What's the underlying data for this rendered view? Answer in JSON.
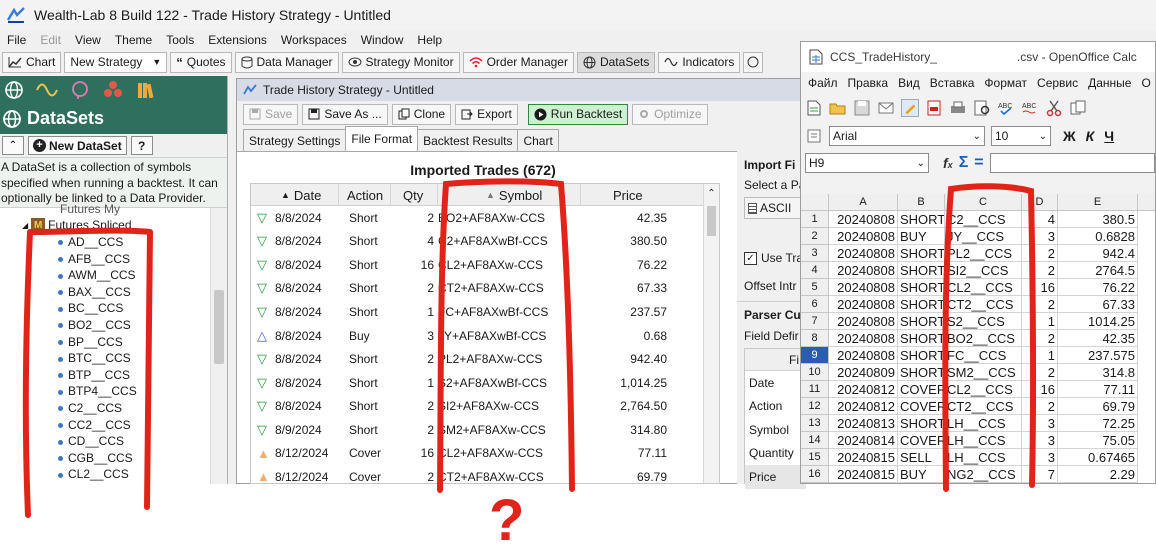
{
  "wl": {
    "title": "Wealth-Lab 8 Build 122 - Trade History Strategy - Untitled",
    "menu": [
      "File",
      "Edit",
      "View",
      "Theme",
      "Tools",
      "Extensions",
      "Workspaces",
      "Window",
      "Help"
    ],
    "toolbar": {
      "chart": "Chart",
      "new_strategy": "New Strategy",
      "quotes": "Quotes",
      "data_manager": "Data Manager",
      "strategy_monitor": "Strategy Monitor",
      "order_manager": "Order Manager",
      "datasets": "DataSets",
      "indicators": "Indicators"
    }
  },
  "datasets_panel": {
    "title": "DataSets",
    "new_dataset": "New DataSet",
    "help": "?",
    "description": "A DataSet is a collection of symbols specified when running a backtest. It can optionally be linked to a Data Provider.",
    "partial_item": "Futures My",
    "folder": "Futures Spliced",
    "symbols": [
      "AD__CCS",
      "AFB__CCS",
      "AWM__CCS",
      "BAX__CCS",
      "BC__CCS",
      "BO2__CCS",
      "BP__CCS",
      "BTC__CCS",
      "BTP__CCS",
      "BTP4__CCS",
      "C2__CCS",
      "CC2__CCS",
      "CD__CCS",
      "CGB__CCS",
      "CL2__CCS"
    ]
  },
  "strategy": {
    "title": "Trade History Strategy - Untitled",
    "buttons": {
      "save": "Save",
      "save_as": "Save As ...",
      "clone": "Clone",
      "export": "Export",
      "run": "Run Backtest",
      "optimize": "Optimize"
    },
    "tabs": [
      "Strategy Settings",
      "File Format",
      "Backtest Results",
      "Chart"
    ],
    "imported_title": "Imported Trades (672)",
    "columns": [
      "Date",
      "Action",
      "Qty",
      "Symbol",
      "Price"
    ],
    "trades": [
      {
        "date": "8/8/2024",
        "action": "Short",
        "qty": "2",
        "symbol": "BO2+AF8AXw-CCS",
        "price": "42.35",
        "kind": "short"
      },
      {
        "date": "8/8/2024",
        "action": "Short",
        "qty": "4",
        "symbol": "C2+AF8AXwBf-CCS",
        "price": "380.50",
        "kind": "short"
      },
      {
        "date": "8/8/2024",
        "action": "Short",
        "qty": "16",
        "symbol": "CL2+AF8AXw-CCS",
        "price": "76.22",
        "kind": "short"
      },
      {
        "date": "8/8/2024",
        "action": "Short",
        "qty": "2",
        "symbol": "CT2+AF8AXw-CCS",
        "price": "67.33",
        "kind": "short"
      },
      {
        "date": "8/8/2024",
        "action": "Short",
        "qty": "1",
        "symbol": "FC+AF8AXwBf-CCS",
        "price": "237.57",
        "kind": "short"
      },
      {
        "date": "8/8/2024",
        "action": "Buy",
        "qty": "3",
        "symbol": "JY+AF8AXwBf-CCS",
        "price": "0.68",
        "kind": "buy"
      },
      {
        "date": "8/8/2024",
        "action": "Short",
        "qty": "2",
        "symbol": "PL2+AF8AXw-CCS",
        "price": "942.40",
        "kind": "short"
      },
      {
        "date": "8/8/2024",
        "action": "Short",
        "qty": "1",
        "symbol": "S2+AF8AXwBf-CCS",
        "price": "1,014.25",
        "kind": "short"
      },
      {
        "date": "8/8/2024",
        "action": "Short",
        "qty": "2",
        "symbol": "SI2+AF8AXw-CCS",
        "price": "2,764.50",
        "kind": "short"
      },
      {
        "date": "8/9/2024",
        "action": "Short",
        "qty": "2",
        "symbol": "SM2+AF8AXw-CCS",
        "price": "314.80",
        "kind": "short"
      },
      {
        "date": "8/12/2024",
        "action": "Cover",
        "qty": "16",
        "symbol": "CL2+AF8AXw-CCS",
        "price": "77.11",
        "kind": "cover"
      },
      {
        "date": "8/12/2024",
        "action": "Cover",
        "qty": "2",
        "symbol": "CT2+AF8AXw-CCS",
        "price": "69.79",
        "kind": "cover"
      }
    ],
    "right_panel": {
      "import_label": "Import Fi",
      "select_label": "Select a Pa",
      "ascii": "ASCII",
      "use_label": "Use Tra",
      "offset_label": "Offset Intr",
      "parser_label": "Parser Cu",
      "field_def": "Field Defir",
      "fi_header": "Fi",
      "fields": [
        "Date",
        "Action",
        "Symbol",
        "Quantity",
        "Price"
      ]
    }
  },
  "calc": {
    "title": "CCS_TradeHistory_",
    "title_suffix": ".csv - OpenOffice Calc",
    "menu": [
      "Файл",
      "Правка",
      "Вид",
      "Вставка",
      "Формат",
      "Сервис",
      "Данные",
      "О"
    ],
    "font": "Arial",
    "size": "10",
    "bold": "Ж",
    "italic": "К",
    "underline": "Ч",
    "cell_ref": "H9",
    "columns": [
      "A",
      "B",
      "C",
      "D",
      "E"
    ],
    "selected_row": 9,
    "rows": [
      [
        "20240808",
        "SHORT",
        "C2__CCS",
        "4",
        "380.5"
      ],
      [
        "20240808",
        "BUY",
        "JY__CCS",
        "3",
        "0.6828"
      ],
      [
        "20240808",
        "SHORT",
        "PL2__CCS",
        "2",
        "942.4"
      ],
      [
        "20240808",
        "SHORT",
        "SI2__CCS",
        "2",
        "2764.5"
      ],
      [
        "20240808",
        "SHORT",
        "CL2__CCS",
        "16",
        "76.22"
      ],
      [
        "20240808",
        "SHORT",
        "CT2__CCS",
        "2",
        "67.33"
      ],
      [
        "20240808",
        "SHORT",
        "S2__CCS",
        "1",
        "1014.25"
      ],
      [
        "20240808",
        "SHORT",
        "BO2__CCS",
        "2",
        "42.35"
      ],
      [
        "20240808",
        "SHORT",
        "FC__CCS",
        "1",
        "237.575"
      ],
      [
        "20240809",
        "SHORT",
        "SM2__CCS",
        "2",
        "314.8"
      ],
      [
        "20240812",
        "COVER",
        "CL2__CCS",
        "16",
        "77.11"
      ],
      [
        "20240812",
        "COVER",
        "CT2__CCS",
        "2",
        "69.79"
      ],
      [
        "20240813",
        "SHORT",
        "LH__CCS",
        "3",
        "72.25"
      ],
      [
        "20240814",
        "COVER",
        "LH__CCS",
        "3",
        "75.05"
      ],
      [
        "20240815",
        "SELL",
        "LH__CCS",
        "3",
        "0.67465"
      ],
      [
        "20240815",
        "BUY",
        "NG2__CCS",
        "7",
        "2.29"
      ]
    ]
  },
  "annotation": {
    "mark": "?",
    "color": "#e2231a"
  }
}
